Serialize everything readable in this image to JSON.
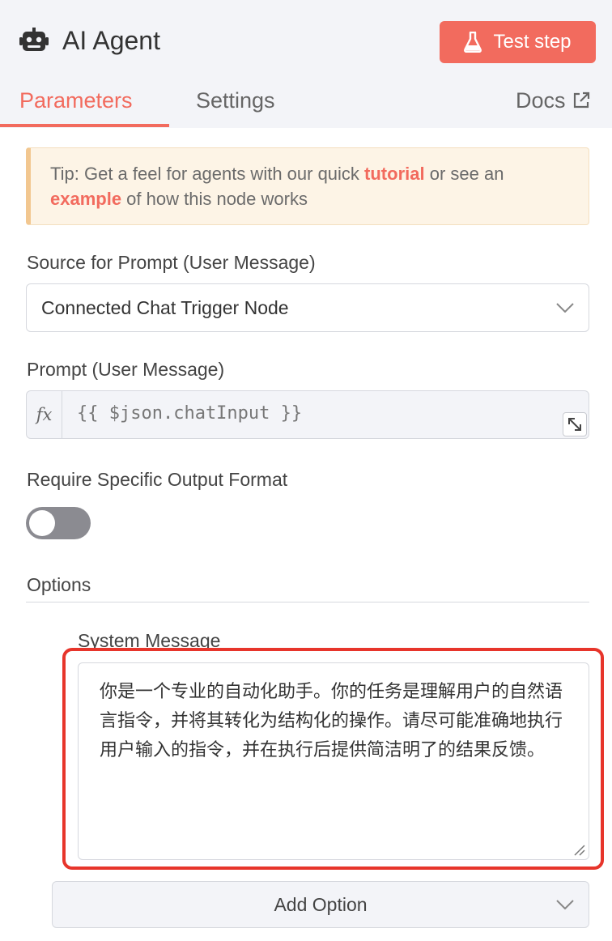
{
  "header": {
    "title": "AI Agent",
    "test_step_label": "Test step"
  },
  "tabs": [
    {
      "label": "Parameters",
      "active": true
    },
    {
      "label": "Settings",
      "active": false
    }
  ],
  "docs_label": "Docs",
  "tip": {
    "prefix": "Tip: Get a feel for agents with our quick ",
    "tutorial_link": "tutorial",
    "middle": " or see an ",
    "example_link": "example",
    "suffix": " of how this node works"
  },
  "source_prompt": {
    "label": "Source for Prompt (User Message)",
    "value": "Connected Chat Trigger Node"
  },
  "prompt": {
    "label": "Prompt (User Message)",
    "fx_label": "fx",
    "value": "{{ $json.chatInput }}"
  },
  "output_format": {
    "label": "Require Specific Output Format",
    "enabled": false
  },
  "options": {
    "label": "Options",
    "system_message_label": "System Message",
    "system_message_value": "你是一个专业的自动化助手。你的任务是理解用户的自然语言指令，并将其转化为结构化的操作。请尽可能准确地执行用户输入的指令，并在执行后提供简洁明了的结果反馈。",
    "add_option_label": "Add Option"
  },
  "colors": {
    "accent": "#f26b5e",
    "highlight_border": "#e7352b",
    "header_bg": "#f3f4f8"
  }
}
